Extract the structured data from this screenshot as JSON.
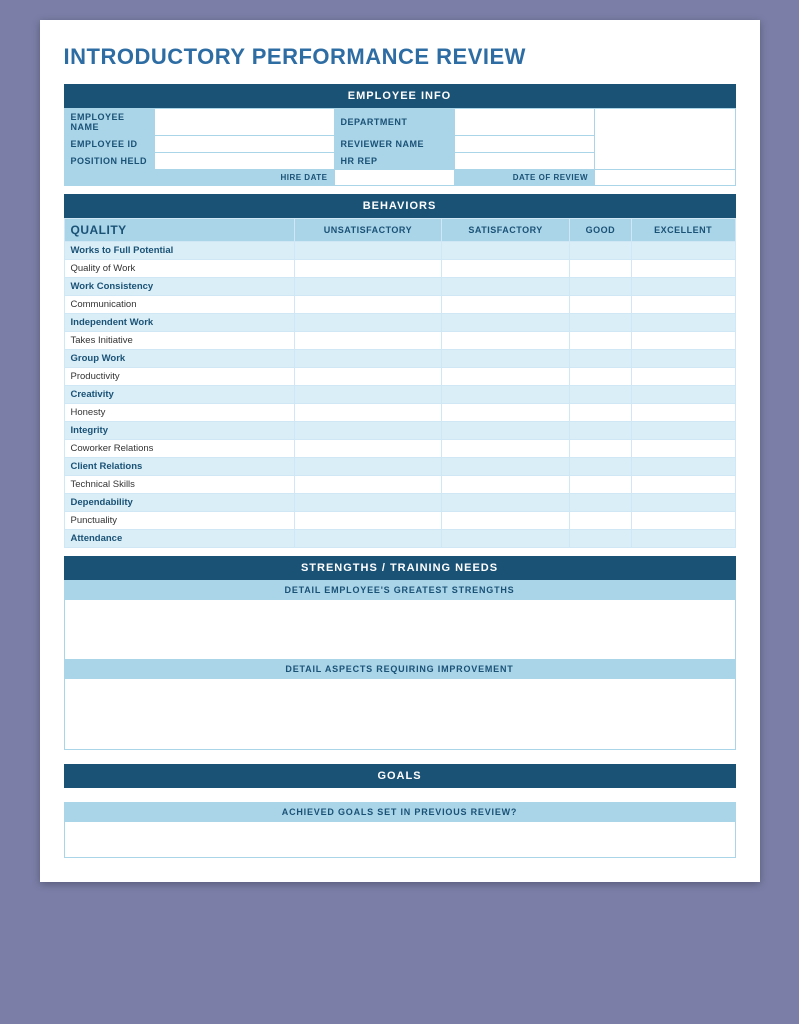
{
  "title": "INTRODUCTORY PERFORMANCE REVIEW",
  "employee_info": {
    "section_header": "EMPLOYEE INFO",
    "fields": [
      {
        "label": "EMPLOYEE NAME",
        "label2": "DEPARTMENT"
      },
      {
        "label": "EMPLOYEE ID",
        "label2": "REVIEWER NAME"
      },
      {
        "label": "POSITION HELD",
        "label2": "HR REP"
      },
      {
        "label": "HIRE DATE",
        "label2": "DATE OF REVIEW"
      }
    ]
  },
  "behaviors": {
    "section_header": "BEHAVIORS",
    "quality_label": "QUALITY",
    "columns": [
      "UNSATISFACTORY",
      "SATISFACTORY",
      "GOOD",
      "EXCELLENT"
    ],
    "rows": [
      "Works to Full Potential",
      "Quality of Work",
      "Work Consistency",
      "Communication",
      "Independent Work",
      "Takes Initiative",
      "Group Work",
      "Productivity",
      "Creativity",
      "Honesty",
      "Integrity",
      "Coworker Relations",
      "Client Relations",
      "Technical Skills",
      "Dependability",
      "Punctuality",
      "Attendance"
    ]
  },
  "strengths": {
    "section_header": "STRENGTHS / TRAINING NEEDS",
    "strengths_label": "DETAIL EMPLOYEE'S GREATEST STRENGTHS",
    "improvement_label": "DETAIL ASPECTS REQUIRING IMPROVEMENT"
  },
  "goals": {
    "section_header": "GOALS",
    "achieved_label": "ACHIEVED GOALS SET IN PREVIOUS REVIEW?"
  }
}
